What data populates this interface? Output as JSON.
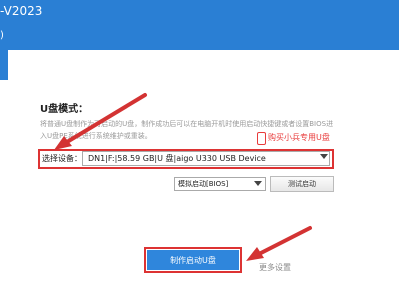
{
  "app": {
    "title": "-V2023",
    "mark": ")"
  },
  "usb_mode": {
    "section_title": "U盘模式：",
    "description": "将普通U盘制作为可启动的U盘，制作成功后可以在电脑开机时使用启动快捷键或者设置BIOS进入U盘PE系统进行系统维护或重装。",
    "buy_link": "购买小兵专用U盘",
    "device_label": "选择设备：",
    "device_value": "DN1|F:|58.59 GB|U 盘|aigo U330 USB Device",
    "boot_mode_value": "模拟启动[BIOS]",
    "test_button": "测试启动",
    "make_button": "制作启动U盘",
    "more_settings": "更多设置"
  },
  "colors": {
    "brand_blue": "#2a7fd4",
    "button_blue": "#2f86dc",
    "annotation_red": "#d33333"
  }
}
